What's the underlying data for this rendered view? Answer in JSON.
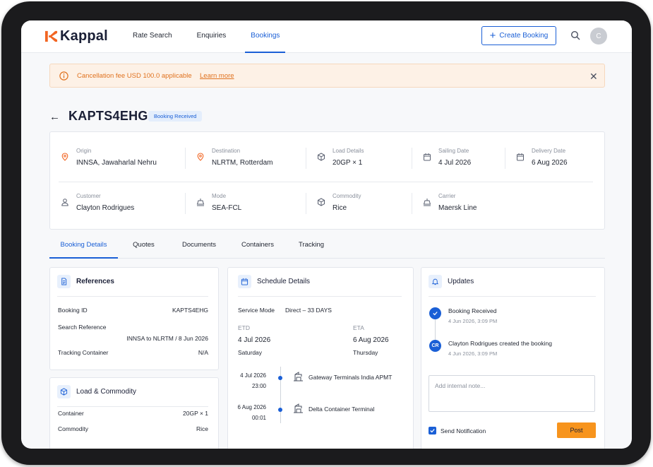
{
  "app": {
    "brand": "Kappal"
  },
  "nav": {
    "items": [
      {
        "label": "Rate Search"
      },
      {
        "label": "Enquiries"
      },
      {
        "label": "Bookings"
      }
    ]
  },
  "header": {
    "create_label": "Create Booking",
    "avatar_initial": "C"
  },
  "banner": {
    "message": "Cancellation fee USD 100.0 applicable",
    "link": "Learn more",
    "close": "✕"
  },
  "booking": {
    "id": "KAPTS4EHG",
    "status": "Booking Received"
  },
  "summary": {
    "origin": {
      "label": "Origin",
      "value": "INNSA, Jawaharlal Nehru"
    },
    "destination": {
      "label": "Destination",
      "value": "NLRTM, Rotterdam"
    },
    "load": {
      "label": "Load Details",
      "value": "20GP × 1"
    },
    "sailing": {
      "label": "Sailing Date",
      "value": "4 Jul 2026"
    },
    "delivery": {
      "label": "Delivery Date",
      "value": "6 Aug 2026"
    },
    "customer": {
      "label": "Customer",
      "value": "Clayton Rodrigues"
    },
    "mode": {
      "label": "Mode",
      "value": "SEA-FCL"
    },
    "commodity": {
      "label": "Commodity",
      "value": "Rice"
    },
    "carrier": {
      "label": "Carrier",
      "value": "Maersk Line"
    }
  },
  "tabs": [
    {
      "label": "Booking Details"
    },
    {
      "label": "Quotes"
    },
    {
      "label": "Documents"
    },
    {
      "label": "Containers"
    },
    {
      "label": "Tracking"
    }
  ],
  "references": {
    "title": "References",
    "booking_id_label": "Booking ID",
    "booking_id": "KAPTS4EHG",
    "search_ref_label": "Search Reference",
    "search_ref": "INNSA to NLRTM / 8 Jun 2026",
    "tracking_label": "Tracking Container",
    "tracking": "N/A"
  },
  "load_commodity": {
    "title": "Load & Commodity",
    "container_label": "Container",
    "container": "20GP × 1",
    "commodity_label": "Commodity",
    "commodity": "Rice"
  },
  "schedule": {
    "title": "Schedule Details",
    "service_mode_label": "Service Mode",
    "service_mode": "Direct – 33 DAYS",
    "etd_label": "ETD",
    "etd_date": "4 Jul 2026",
    "etd_day": "Saturday",
    "eta_label": "ETA",
    "eta_date": "6 Aug 2026",
    "eta_day": "Thursday",
    "stops": [
      {
        "date": "4 Jul 2026",
        "time": "23:00",
        "name": "Gateway Terminals India APMT"
      },
      {
        "date": "6 Aug 2026",
        "time": "00:01",
        "name": "Delta Container Terminal"
      }
    ]
  },
  "updates": {
    "title": "Updates",
    "items": [
      {
        "text": "Booking Received",
        "time": "4 Jun 2026, 3:09 PM"
      },
      {
        "initials": "CR",
        "text": "Clayton Rodrigues created the booking",
        "time": "4 Jun 2026, 3:09 PM"
      }
    ],
    "note_placeholder": "Add internal note...",
    "send_notification": "Send Notification",
    "post_label": "Post"
  },
  "colors": {
    "accent": "#1a5fd6",
    "brand_orange": "#f26522",
    "post": "#f7941d"
  }
}
